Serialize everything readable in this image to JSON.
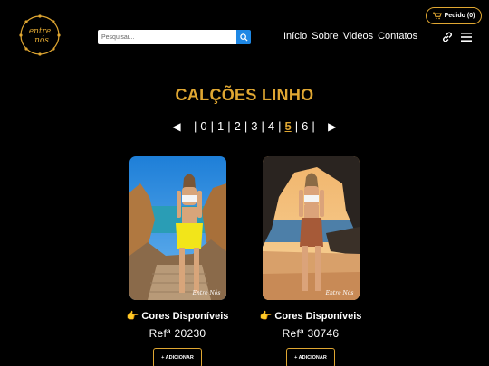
{
  "header": {
    "order_button": "Pedido (0)",
    "search_placeholder": "Pesquisar...",
    "nav": [
      "Início",
      "Sobre",
      "Videos",
      "Contatos"
    ],
    "logo_text": "entre nós"
  },
  "page_title": "CALÇÕES LINHO",
  "pagination": {
    "prev": "◀",
    "next": "▶",
    "pages": [
      "0",
      "1",
      "2",
      "3",
      "4",
      "5",
      "6"
    ],
    "active": "5"
  },
  "products": [
    {
      "colors_label": "Cores Disponíveis",
      "ref": "Refª 20230",
      "add_label": "+ ADICIONAR",
      "watermark": "Entre Nós"
    },
    {
      "colors_label": "Cores Disponíveis",
      "ref": "Refª 30746",
      "add_label": "+ ADICIONAR",
      "watermark": "Entre Nós"
    }
  ],
  "colors": {
    "accent": "#e0a732",
    "background": "#000000",
    "search_button": "#1e88e5"
  }
}
